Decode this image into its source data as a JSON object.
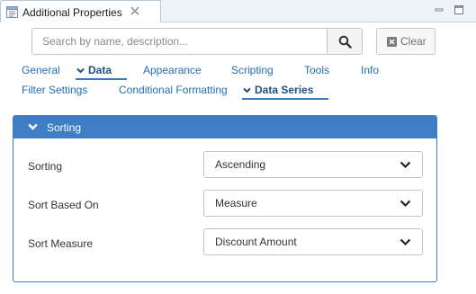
{
  "window": {
    "tab_title": "Additional Properties",
    "icons": {
      "tab": "properties-icon",
      "close": "close-icon",
      "minimize": "minimize-icon",
      "maximize": "maximize-icon"
    }
  },
  "search": {
    "placeholder": "Search by name, description...",
    "value": "",
    "search_icon": "search-icon",
    "clear_label": "Clear",
    "clear_icon": "clear-x-icon"
  },
  "nav": {
    "row1": [
      {
        "label": "General",
        "active": false
      },
      {
        "label": "Data",
        "active": true
      },
      {
        "label": "Appearance",
        "active": false
      },
      {
        "label": "Scripting",
        "active": false
      },
      {
        "label": "Tools",
        "active": false
      },
      {
        "label": "Info",
        "active": false
      }
    ],
    "row2": [
      {
        "label": "Filter Settings",
        "active": false
      },
      {
        "label": "Conditional Formatting",
        "active": false
      },
      {
        "label": "Data Series",
        "active": true
      }
    ]
  },
  "section": {
    "title": "Sorting",
    "expanded": true,
    "fields": [
      {
        "label": "Sorting",
        "value": "Ascending"
      },
      {
        "label": "Sort Based On",
        "value": "Measure"
      },
      {
        "label": "Sort Measure",
        "value": "Discount Amount"
      }
    ]
  },
  "colors": {
    "accent": "#3d7ec5",
    "link": "#1f6fb5",
    "active_link": "#1d4f86",
    "titlebar": "#eef3fa"
  }
}
